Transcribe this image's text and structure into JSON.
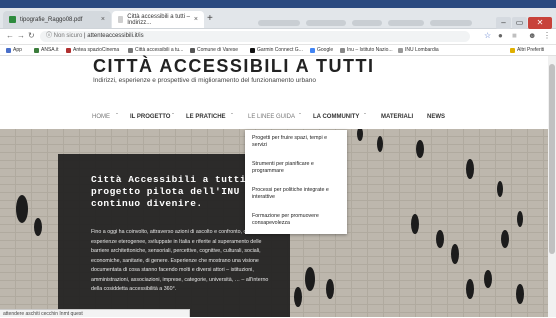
{
  "browser": {
    "tabs": [
      {
        "label": "tipografie_Raggo08.pdf",
        "close": "×"
      },
      {
        "label": "Città accessibili a tutti – Indirizz...",
        "close": "×"
      }
    ],
    "new_tab": "+",
    "url_secure": "Non sicuro",
    "url": "attenteaccessibili.it/is",
    "window_controls": [
      "–",
      "▭",
      "✕"
    ],
    "bookmarks": [
      {
        "label": "App",
        "color": "#4a6fc9"
      },
      {
        "label": "ANSA.it",
        "color": "#3b7d3b"
      },
      {
        "label": "Antea spazioCinema",
        "color": "#b03030"
      },
      {
        "label": "Città accessibili a tu...",
        "color": "#777777"
      },
      {
        "label": "Comune di Varese",
        "color": "#555555"
      },
      {
        "label": "Garmin Connect G...",
        "color": "#111111"
      },
      {
        "label": "Google",
        "color": "#4285f4"
      },
      {
        "label": "Inu – Istituto Nazio...",
        "color": "#888888"
      },
      {
        "label": "INU Lombardia",
        "color": "#999999"
      },
      {
        "label": "Altri Preferiti",
        "color": "#e0b000"
      }
    ]
  },
  "site": {
    "title": "CITTÀ ACCESSIBILI A TUTTI",
    "subtitle": "Indirizzi, esperienze e prospettive di miglioramento del funzionamento urbano",
    "menu": [
      "HOME",
      "IL PROGETTO",
      "LE PRATICHE",
      "LE LINEE GUIDA",
      "LA COMMUNITY",
      "MATERIALI",
      "NEWS"
    ],
    "dropdown": [
      "Progetti per fruire spazi, tempi e servizi",
      "Strumenti per pianificare e programmare",
      "Processi per politiche integrate e interattive",
      "Formazione per promuovere consapevolezza"
    ],
    "hero_headline": "Città Accessibili a tutti è un progetto pilota dell'INU in continuo divenire.",
    "hero_body": "Fino a oggi ha coinvolto, attraverso azioni di ascolto e confronto, oltre 120 esperienze eterogenee, sviluppate in Italia e riferite al superamento delle barriere architettoniche, sensoriali, percettive, cognitive, culturali, sociali, economiche, sanitarie, di genere. Esperienze che mostrano una visione documentata di cosa stanno facendo molti e diversi attori – istituzioni, amministrazioni, associazioni, imprese, categorie, università, … – all'interno della cosiddetta accessibilità a 360°."
  },
  "status_bar": "attendere aschiti cecchin Inmt quest"
}
